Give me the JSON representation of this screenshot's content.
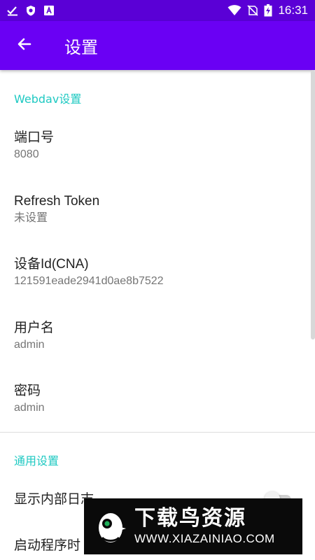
{
  "status_bar": {
    "time": "16:31",
    "left_icons": [
      "download-done-icon",
      "shield-icon",
      "font-a-icon"
    ],
    "right_icons": [
      "wifi-icon",
      "no-sim-icon",
      "battery-charging-icon"
    ]
  },
  "app_bar": {
    "title": "设置",
    "back_icon": "arrow-back-icon",
    "color": "#6a00f4"
  },
  "sections": {
    "webdav": {
      "header": "Webdav设置",
      "items": [
        {
          "title": "端口号",
          "summary": "8080"
        },
        {
          "title": "Refresh Token",
          "summary": "未设置"
        },
        {
          "title": "设备Id(CNA)",
          "summary": "121591eade2941d0ae8b7522"
        },
        {
          "title": "用户名",
          "summary": "admin"
        },
        {
          "title": "密码",
          "summary": "admin"
        }
      ]
    },
    "general": {
      "header": "通用设置",
      "items": [
        {
          "title": "显示内部日志",
          "switch_on": false
        },
        {
          "title": "启动程序时"
        }
      ]
    }
  },
  "watermark": {
    "brand": "下载鸟资源",
    "url": "WWW.XIAZAINIAO.COM"
  },
  "colors": {
    "section_header": "#1ec9c2",
    "status_bar": "#5a00d6"
  }
}
